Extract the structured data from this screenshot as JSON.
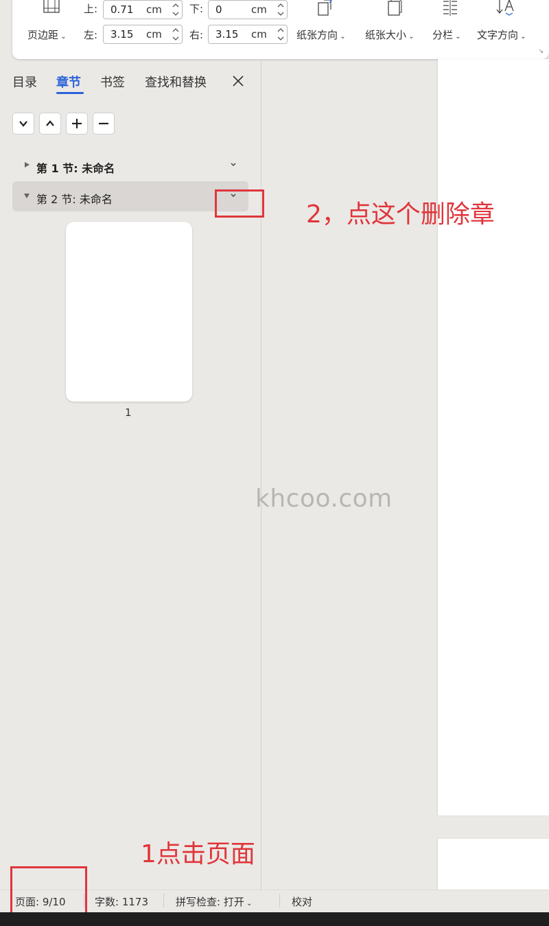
{
  "ribbon": {
    "margins_label": "页边距",
    "top_label": "上:",
    "top_value": "0.71",
    "bottom_label": "下:",
    "bottom_value": "0",
    "left_label": "左:",
    "left_value": "3.15",
    "right_label": "右:",
    "right_value": "3.15",
    "unit": "cm",
    "orientation_label": "纸张方向",
    "size_label": "纸张大小",
    "columns_label": "分栏",
    "text_direction_label": "文字方向"
  },
  "nav": {
    "tabs": [
      {
        "label": "目录",
        "active": false
      },
      {
        "label": "章节",
        "active": true
      },
      {
        "label": "书签",
        "active": false
      },
      {
        "label": "查找和替换",
        "active": false
      }
    ],
    "sections": [
      {
        "label": "第 1 节: 未命名",
        "expanded": false,
        "selected": false
      },
      {
        "label": "第 2 节: 未命名",
        "expanded": true,
        "selected": true
      }
    ],
    "thumbnail_page_number": "1"
  },
  "watermark": "khcoo.com",
  "annotations": {
    "step1": "1点击页面",
    "step2": "2，点这个删除章"
  },
  "status": {
    "page": "页面: 9/10",
    "word_count": "字数: 1173",
    "spell_check": "拼写检查: 打开",
    "proofread": "校对"
  },
  "colors": {
    "accent": "#2b62d8",
    "annotation_red": "#e0353b",
    "pane_bg": "#ebe9e6",
    "selected_row": "#d9d6d3"
  }
}
